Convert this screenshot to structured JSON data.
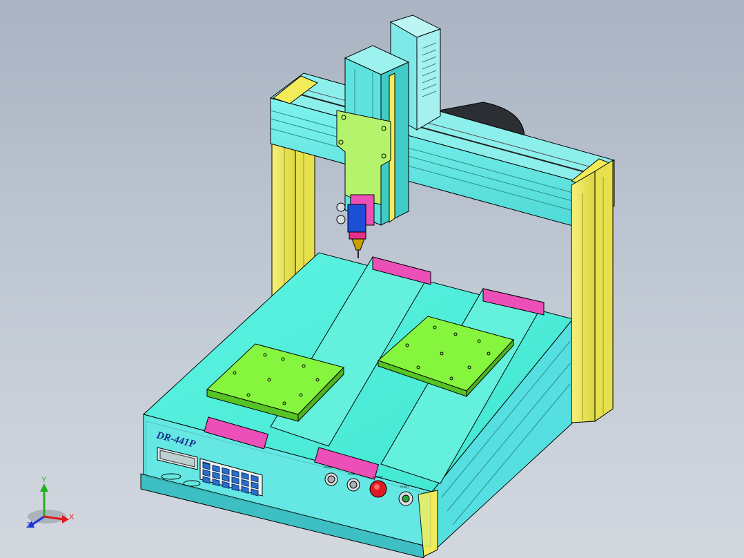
{
  "machine": {
    "model_label": "DR-441P",
    "panel_buttons": [
      {
        "label": "RESET",
        "color": "#d8dde0"
      },
      {
        "label": "STOP",
        "color": "#d8dde0"
      },
      {
        "label": "E-STOP",
        "color": "#e01a22"
      },
      {
        "label": "START",
        "color": "#29a83b"
      }
    ]
  },
  "triad": {
    "x": "X",
    "y": "Y",
    "z": "Z"
  },
  "colors": {
    "background_top": "#a9b3c2",
    "cyan": "#5eeae6",
    "yellow": "#f2ec5a",
    "green": "#86f53e",
    "magenta": "#ec4fb8",
    "light_green": "#b4f46b"
  }
}
